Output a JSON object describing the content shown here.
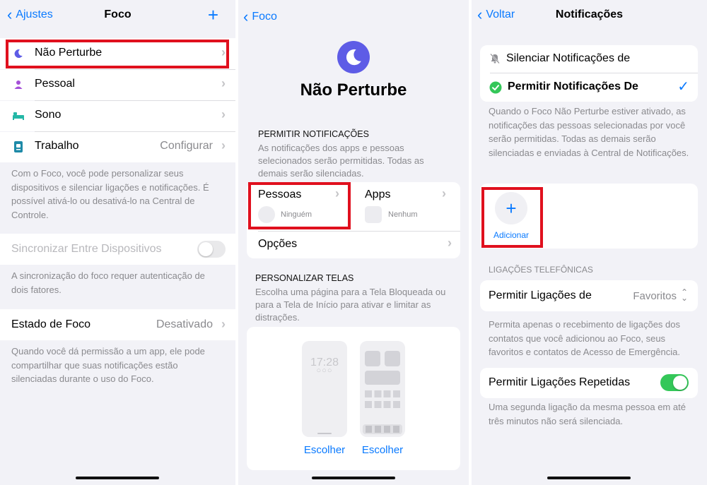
{
  "colors": {
    "accent": "#0a7aff",
    "highlight": "#e0101e",
    "green": "#34c759",
    "moon": "#5e5ce6"
  },
  "p1": {
    "back": "Ajustes",
    "title": "Foco",
    "add": "+",
    "items": [
      {
        "label": "Não Perturbe",
        "value": "",
        "icon": "moon-icon"
      },
      {
        "label": "Pessoal",
        "value": "",
        "icon": "person-icon"
      },
      {
        "label": "Sono",
        "value": "",
        "icon": "bed-icon"
      },
      {
        "label": "Trabalho",
        "value": "Configurar",
        "icon": "badge-icon"
      }
    ],
    "foot1": "Com o Foco, você pode personalizar seus dispositivos e silenciar ligações e notificações. É possível ativá-lo ou desativá-lo na Central de Controle.",
    "sync_label": "Sincronizar Entre Dispositivos",
    "sync_on": false,
    "foot2": "A sincronização do foco requer autenticação de dois fatores.",
    "state_label": "Estado de Foco",
    "state_value": "Desativado",
    "foot3": "Quando você dá permissão a um app, ele pode compartilhar que suas notificações estão silenciadas durante o uso do Foco."
  },
  "p2": {
    "back": "Foco",
    "title": "Não Perturbe",
    "section1_header": "PERMITIR NOTIFICAÇÕES",
    "section1_desc": "As notificações dos apps e pessoas selecionados serão permitidas. Todas as demais serão silenciadas.",
    "people_label": "Pessoas",
    "people_value": "Ninguém",
    "apps_label": "Apps",
    "apps_value": "Nenhum",
    "options_label": "Opções",
    "section2_header": "PERSONALIZAR TELAS",
    "section2_desc": "Escolha uma página para a Tela Bloqueada ou para a Tela de Início para ativar e limitar as distrações.",
    "lock_time": "17:28",
    "choose1": "Escolher",
    "choose2": "Escolher"
  },
  "p3": {
    "back": "Voltar",
    "title": "Notificações",
    "opt1": "Silenciar Notificações de",
    "opt2": "Permitir Notificações De",
    "desc1": "Quando o Foco Não Perturbe estiver ativado, as notificações das pessoas selecionadas por você serão permitidas. Todas as demais serão silenciadas e enviadas à Central de Notificações.",
    "add_label": "Adicionar",
    "calls_header": "LIGAÇÕES TELEFÔNICAS",
    "calls_label": "Permitir Ligações de",
    "calls_value": "Favoritos",
    "desc2": "Permita apenas o recebimento de ligações dos contatos que você adicionou ao Foco, seus favoritos e contatos de Acesso de Emergência.",
    "repeat_label": "Permitir Ligações Repetidas",
    "repeat_on": true,
    "desc3": "Uma segunda ligação da mesma pessoa em até três minutos não será silenciada."
  }
}
